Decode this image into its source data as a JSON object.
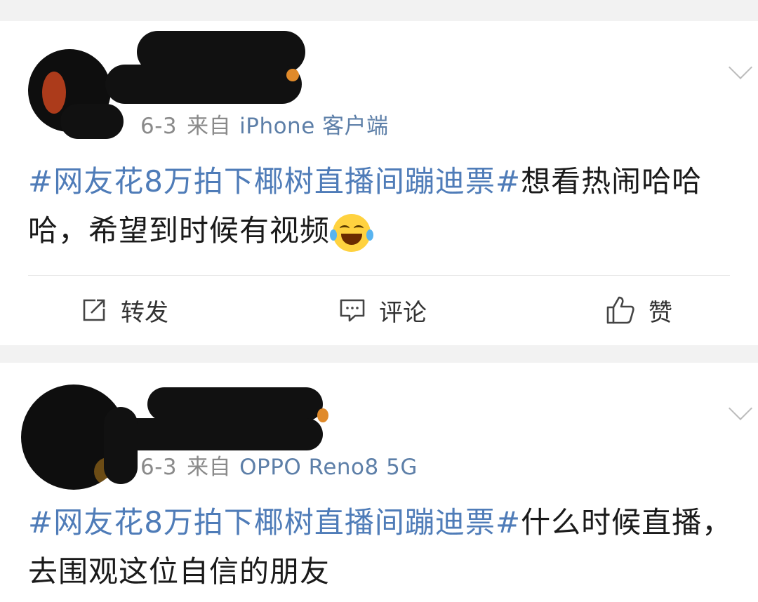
{
  "posts": [
    {
      "date": "6-3",
      "from_label": "来自",
      "source": "iPhone 客户端",
      "topic": "#网友花8万拍下椰树直播间蹦迪票#",
      "text": "想看热闹哈哈哈，希望到时候有视频",
      "emoji": "laughing-with-tears-emoji",
      "actions": {
        "repost": "转发",
        "comment": "评论",
        "like": "赞"
      }
    },
    {
      "date": "6-3",
      "from_label": "来自",
      "source": "OPPO Reno8 5G",
      "topic": "#网友花8万拍下椰树直播间蹦迪票#",
      "text": "什么时候直播，去围观这位自信的朋友"
    }
  ],
  "colors": {
    "topic": "#4f7cb8",
    "source": "#5d7fa8",
    "meta": "#8a8a8a",
    "background": "#f2f2f2"
  }
}
